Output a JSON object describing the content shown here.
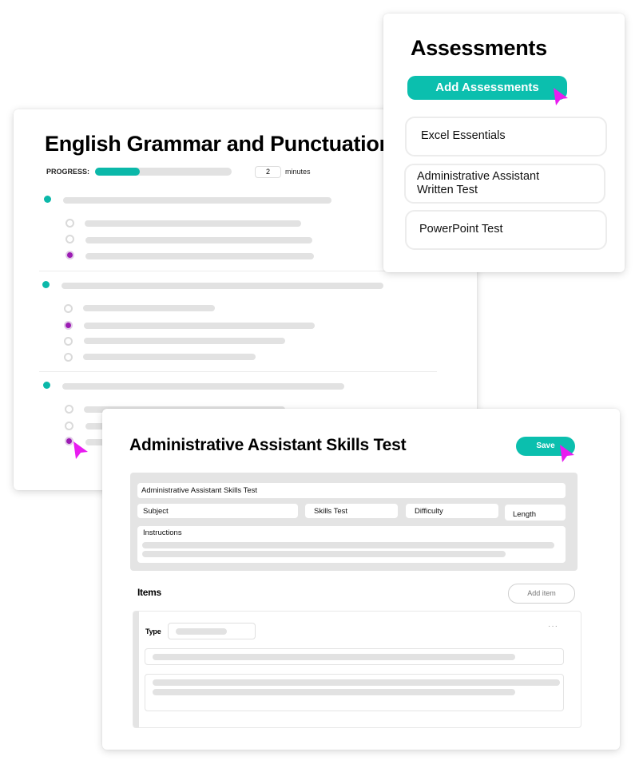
{
  "english_card": {
    "title": "English Grammar and Punctuation",
    "progress_label": "PROGRESS:",
    "progress_fraction": 0.33,
    "minutes_value": "2",
    "minutes_label": "minutes",
    "questions": [
      {
        "options": 3,
        "selected_index": 2
      },
      {
        "options": 4,
        "selected_index": 1
      },
      {
        "options": 3,
        "selected_index": 2
      }
    ]
  },
  "assessments_card": {
    "title": "Assessments",
    "add_button_label": "Add Assessments",
    "items": [
      {
        "label": "Excel Essentials"
      },
      {
        "label": "Administrative Assistant Written Test"
      },
      {
        "label": "PowerPoint Test"
      }
    ]
  },
  "skills_card": {
    "title": "Administrative Assistant Skills Test",
    "save_label": "Save",
    "form": {
      "name_value": "Administrative Assistant Skills Test",
      "subject_placeholder": "Subject",
      "type_value": "Skills Test",
      "difficulty_placeholder": "Difficulty",
      "length_placeholder": "Length",
      "instructions_label": "Instructions"
    },
    "items_label": "Items",
    "add_item_label": "Add item",
    "item": {
      "type_label": "Type",
      "more_icon": "more-horizontal-icon"
    }
  },
  "colors": {
    "accent": "#0bbfae",
    "selected_radio": "#9c1bb4",
    "cursor": "#e81cf0",
    "placeholder_bar": "#e2e2e2"
  }
}
